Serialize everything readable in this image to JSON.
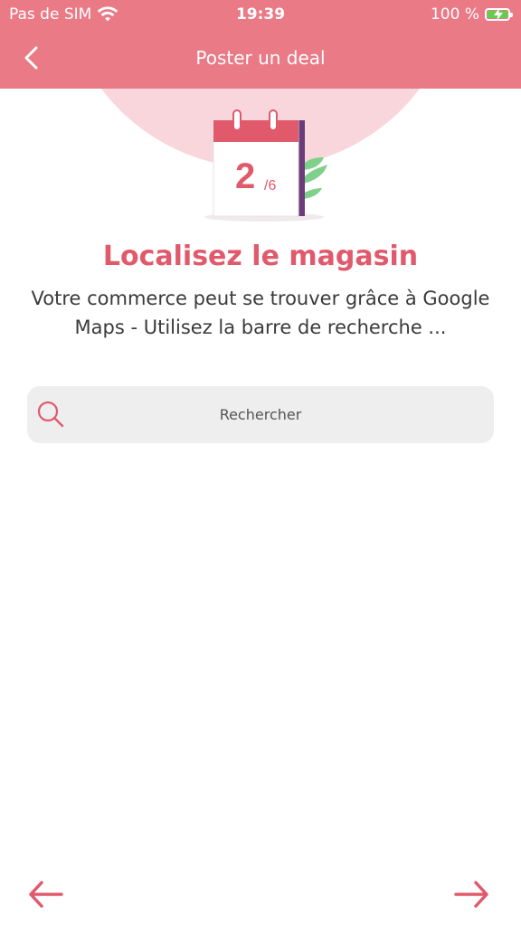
{
  "status_bar": {
    "carrier": "Pas de SIM",
    "time": "19:39",
    "battery": "100 %"
  },
  "header": {
    "title": "Poster un deal",
    "back_icon": "chevron-left-icon"
  },
  "step": {
    "current": "2",
    "total": "/6"
  },
  "main": {
    "heading": "Localisez le magasin",
    "description": "Votre commerce peut se trouver grâce à Google Maps - Utilisez la barre de recherche ..."
  },
  "search": {
    "placeholder": "Rechercher",
    "icon": "search-icon"
  },
  "footer": {
    "prev_icon": "arrow-left-icon",
    "next_icon": "arrow-right-icon"
  },
  "colors": {
    "header_bg": "#e97a86",
    "accent": "#e05a6c",
    "circle_bg": "#f8d6db",
    "leaf": "#7fd08a",
    "calendar_side": "#6a3d7a"
  }
}
